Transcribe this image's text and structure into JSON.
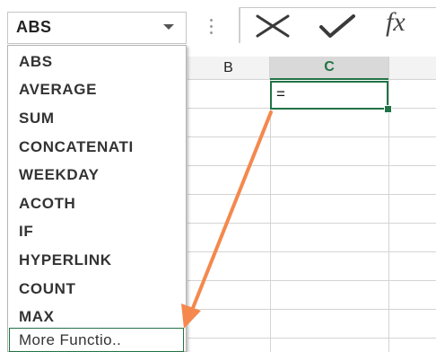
{
  "name_box": {
    "value": "ABS"
  },
  "formula_bar": {
    "icons": [
      "more-options-dots-icon",
      "cancel-x-icon",
      "enter-checkmark-icon",
      "insert-function-fx-icon"
    ],
    "fx_label": "fx"
  },
  "grid": {
    "columns": [
      {
        "id": "B",
        "label": "B"
      },
      {
        "id": "C",
        "label": "C"
      }
    ],
    "active_cell": {
      "column": "C",
      "text": "="
    },
    "accent_color": "#217346"
  },
  "function_dropdown": {
    "items": [
      {
        "label": "ABS"
      },
      {
        "label": "AVERAGE"
      },
      {
        "label": "SUM"
      },
      {
        "label": "CONCATENATI"
      },
      {
        "label": "WEEKDAY"
      },
      {
        "label": "ACOTH"
      },
      {
        "label": "IF"
      },
      {
        "label": "HYPERLINK"
      },
      {
        "label": "COUNT"
      },
      {
        "label": "MAX"
      }
    ],
    "more_functions": "More Functio.."
  },
  "annotation": {
    "arrow_color": "#f4884d",
    "icon": "pointer-arrow-icon"
  }
}
